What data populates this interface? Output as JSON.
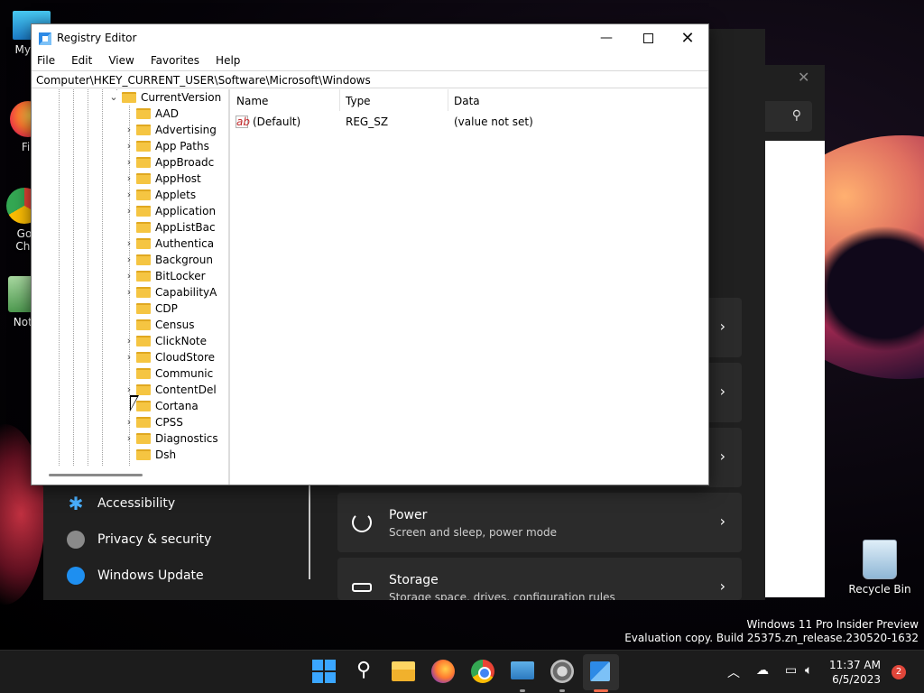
{
  "desktop": {
    "icons": [
      {
        "label": "My Co"
      },
      {
        "label": "Fir"
      },
      {
        "label": "Go Chi"
      },
      {
        "label": "Note"
      }
    ],
    "recycle_bin": "Recycle Bin",
    "watermark_line1": "Windows 11 Pro Insider Preview",
    "watermark_line2": "Evaluation copy. Build 25375.zn_release.230520-1632"
  },
  "settings": {
    "nav": [
      {
        "label": "Accessibility",
        "icon": "accessibility-icon"
      },
      {
        "label": "Privacy & security",
        "icon": "shield-icon"
      },
      {
        "label": "Windows Update",
        "icon": "update-icon"
      }
    ],
    "cards": [
      {
        "title": "Power",
        "subtitle": "Screen and sleep, power mode",
        "icon": "power-icon"
      },
      {
        "title": "Storage",
        "subtitle": "Storage space, drives, configuration rules",
        "icon": "storage-icon"
      }
    ]
  },
  "regedit": {
    "title": "Registry Editor",
    "menu": [
      "File",
      "Edit",
      "View",
      "Favorites",
      "Help"
    ],
    "address": "Computer\\HKEY_CURRENT_USER\\Software\\Microsoft\\Windows",
    "tree": {
      "parent": "CurrentVersion",
      "children": [
        {
          "label": "AAD",
          "expandable": false
        },
        {
          "label": "Advertising",
          "expandable": true
        },
        {
          "label": "App Paths",
          "expandable": true
        },
        {
          "label": "AppBroadc",
          "expandable": true
        },
        {
          "label": "AppHost",
          "expandable": true
        },
        {
          "label": "Applets",
          "expandable": true
        },
        {
          "label": "Application",
          "expandable": true
        },
        {
          "label": "AppListBac",
          "expandable": false
        },
        {
          "label": "Authentica",
          "expandable": true
        },
        {
          "label": "Backgroun",
          "expandable": true
        },
        {
          "label": "BitLocker",
          "expandable": true
        },
        {
          "label": "CapabilityA",
          "expandable": true
        },
        {
          "label": "CDP",
          "expandable": false
        },
        {
          "label": "Census",
          "expandable": false
        },
        {
          "label": "ClickNote",
          "expandable": true
        },
        {
          "label": "CloudStore",
          "expandable": true
        },
        {
          "label": "Communic",
          "expandable": false
        },
        {
          "label": "ContentDel",
          "expandable": true
        },
        {
          "label": "Cortana",
          "expandable": false
        },
        {
          "label": "CPSS",
          "expandable": true
        },
        {
          "label": "Diagnostics",
          "expandable": true
        },
        {
          "label": "Dsh",
          "expandable": false
        }
      ]
    },
    "columns": [
      "Name",
      "Type",
      "Data"
    ],
    "rows": [
      {
        "name": "(Default)",
        "type": "REG_SZ",
        "data": "(value not set)"
      }
    ]
  },
  "taskbar": {
    "time": "11:37 AM",
    "date": "6/5/2023",
    "notification_count": "2"
  },
  "colors": {
    "accent": "#3aa6ff",
    "settings_bg": "#202020",
    "card_bg": "#2b2b2b",
    "folder": "#f5c542"
  }
}
